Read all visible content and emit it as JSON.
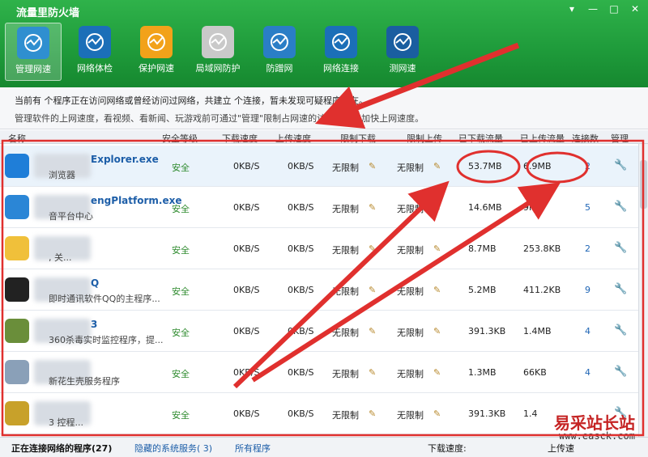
{
  "window": {
    "title": "流量里防火墙",
    "controls": [
      "▾",
      "—",
      "□",
      "✕"
    ]
  },
  "toolbar": [
    {
      "label": "管理网速",
      "icon": "monitor-chart-icon",
      "active": true,
      "color": "#2f8fd0"
    },
    {
      "label": "网络体检",
      "icon": "pulse-globe-icon",
      "active": false,
      "color": "#1b6fb8"
    },
    {
      "label": "保护网速",
      "icon": "lightning-shield-icon",
      "active": false,
      "color": "#f2a21a"
    },
    {
      "label": "局域网防护",
      "icon": "brick-wall-icon",
      "active": false,
      "color": "#c9c9c9"
    },
    {
      "label": "防蹭网",
      "icon": "globe-icon",
      "active": false,
      "color": "#2a7ec6"
    },
    {
      "label": "网络连接",
      "icon": "network-monitor-icon",
      "active": false,
      "color": "#1b6fb8"
    },
    {
      "label": "测网速",
      "icon": "speedometer-icon",
      "active": false,
      "color": "#1a5ea0"
    }
  ],
  "info": {
    "line1": "当前有  个程序正在访问网络或曾经访问过网络，共建立  个连接，暂未发现可疑程序存在。",
    "line2": "管理软件的上网速度，看视频、看新闻、玩游戏前可通过\"管理\"限制占网速的访问网络，加快上网速度。"
  },
  "columns": [
    "名称",
    "安全等级",
    "下载速度",
    "上传速度",
    "限制下载",
    "限制上传",
    "已下载流量",
    "已上传流量",
    "连接数",
    "管理"
  ],
  "rows": [
    {
      "name": "Explorer.exe",
      "desc": "浏览器",
      "safety": "安全",
      "down_speed": "0KB/S",
      "up_speed": "0KB/S",
      "limit_down": "无限制",
      "limit_up": "无限制",
      "downloaded": "53.7MB",
      "uploaded": "6.9MB",
      "connections": "2",
      "icon": "ie-browser-icon",
      "selected": true
    },
    {
      "name": "engPlatform.exe",
      "desc": "音平台中心",
      "safety": "安全",
      "down_speed": "0KB/S",
      "up_speed": "0KB/S",
      "limit_down": "无限制",
      "limit_up": "无限制",
      "downloaded": "14.6MB",
      "uploaded": "9MB",
      "connections": "5",
      "icon": "app-window-icon",
      "selected": false
    },
    {
      "name": "",
      "desc": ", 关...",
      "safety": "安全",
      "down_speed": "0KB/S",
      "up_speed": "0KB/S",
      "limit_down": "无限制",
      "limit_up": "无限制",
      "downloaded": "8.7MB",
      "uploaded": "253.8KB",
      "connections": "2",
      "icon": "globe-app-icon",
      "selected": false
    },
    {
      "name": "Q",
      "desc": "即时通讯软件QQ的主程序...",
      "safety": "安全",
      "down_speed": "0KB/S",
      "up_speed": "0KB/S",
      "limit_down": "无限制",
      "limit_up": "无限制",
      "downloaded": "5.2MB",
      "uploaded": "411.2KB",
      "connections": "9",
      "icon": "qq-penguin-icon",
      "selected": false
    },
    {
      "name": "3",
      "desc": "360杀毒实时监控程序，提...",
      "safety": "安全",
      "down_speed": "0KB/S",
      "up_speed": "0KB/S",
      "limit_down": "无限制",
      "limit_up": "无限制",
      "downloaded": "391.3KB",
      "uploaded": "1.4MB",
      "connections": "4",
      "icon": "antivirus-icon",
      "selected": false
    },
    {
      "name": "",
      "desc": "新花生壳服务程序",
      "safety": "安全",
      "down_speed": "0KB/S",
      "up_speed": "0KB/S",
      "limit_down": "无限制",
      "limit_up": "无限制",
      "downloaded": "1.3MB",
      "uploaded": "66KB",
      "connections": "4",
      "icon": "server-icon",
      "selected": false
    },
    {
      "name": "",
      "desc": "3 控程...",
      "safety": "安全",
      "down_speed": "0KB/S",
      "up_speed": "0KB/S",
      "limit_down": "无限制",
      "limit_up": "无限制",
      "downloaded": "391.3KB",
      "uploaded": "1.4",
      "connections": "",
      "icon": "shield-app-icon",
      "selected": false
    }
  ],
  "footer": {
    "tab_connected": "正在连接网络的程序(27)",
    "tab_hidden": "隐藏的系统服务( 3)",
    "tab_all": "所有程序",
    "download_label": "下载速度:",
    "upload_label": "上传速",
    "watermark": "易采站长站",
    "watermark_url": "www.easck.com"
  },
  "annotation_color": "#e0302e"
}
